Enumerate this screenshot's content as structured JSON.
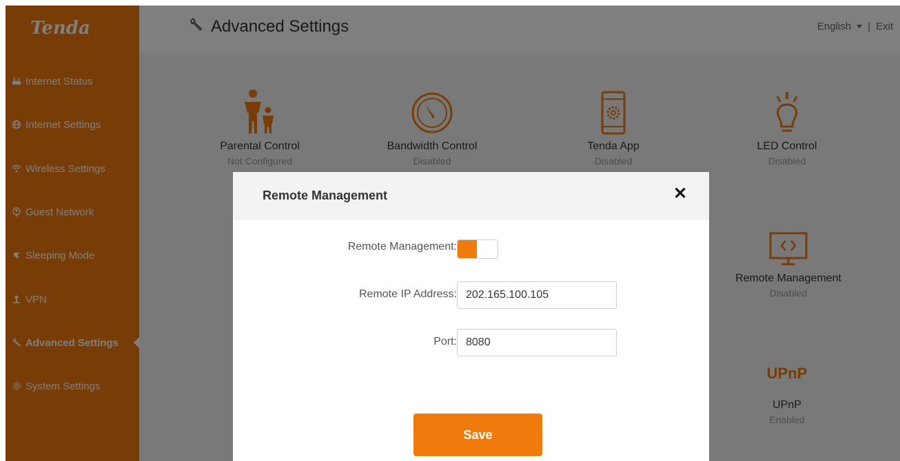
{
  "brand": {
    "logo_text": "Tenda",
    "accent_color": "#f07a0c"
  },
  "sidebar": {
    "items": [
      {
        "label": "Internet Status",
        "icon": "router-icon"
      },
      {
        "label": "Internet Settings",
        "icon": "globe-icon"
      },
      {
        "label": "Wireless Settings",
        "icon": "wifi-icon"
      },
      {
        "label": "Guest Network",
        "icon": "guest-icon"
      },
      {
        "label": "Sleeping Mode",
        "icon": "sleep-icon"
      },
      {
        "label": "VPN",
        "icon": "vpn-icon"
      },
      {
        "label": "Advanced Settings",
        "icon": "wrench-icon",
        "active": true
      },
      {
        "label": "System Settings",
        "icon": "gear-icon"
      }
    ]
  },
  "header": {
    "title": "Advanced Settings",
    "language": "English",
    "separator": "|",
    "exit_label": "Exit"
  },
  "tiles": [
    {
      "name": "Parental Control",
      "status": "Not Configured",
      "icon": "parent-child-icon"
    },
    {
      "name": "Bandwidth Control",
      "status": "Disabled",
      "icon": "speedometer-icon"
    },
    {
      "name": "Tenda App",
      "status": "Disabled",
      "icon": "phone-gear-icon"
    },
    {
      "name": "LED Control",
      "status": "Disabled",
      "icon": "lightbulb-icon"
    },
    {
      "name": "Remote Management",
      "status": "Disabled",
      "icon": "monitor-code-icon"
    },
    {
      "name": "UPnP",
      "status": "Enabled",
      "icon": "upnp-icon",
      "icon_text": "UPnP"
    }
  ],
  "modal": {
    "title": "Remote Management",
    "close_symbol": "✕",
    "remote_management_label": "Remote Management:",
    "remote_management_enabled": true,
    "remote_ip_label": "Remote IP Address:",
    "remote_ip_value": "202.165.100.105",
    "port_label": "Port:",
    "port_value": "8080",
    "save_label": "Save"
  }
}
